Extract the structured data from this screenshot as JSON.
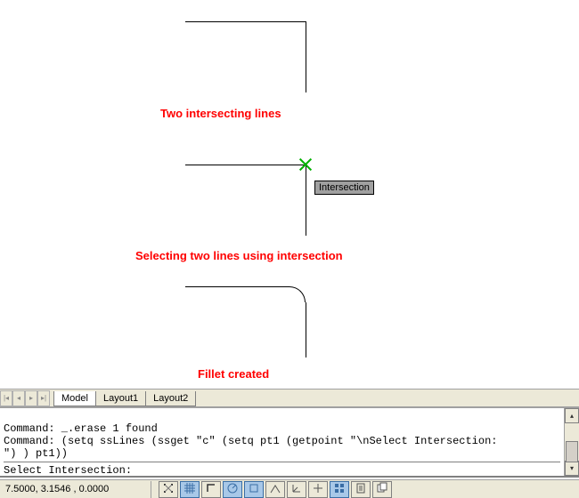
{
  "canvas": {
    "label_two_lines": "Two intersecting lines",
    "label_select_intersection": "Selecting two lines using intersection",
    "label_fillet": "Fillet created",
    "tooltip_intersection": "Intersection",
    "snap_color": "#00b000"
  },
  "tabs": {
    "items": [
      "Model",
      "Layout1",
      "Layout2"
    ],
    "active_index": 0
  },
  "command": {
    "history": [
      "Command: _.erase 1 found",
      "Command: (setq ssLines (ssget \"c\" (setq pt1 (getpoint \"\\nSelect Intersection:",
      "\") ) pt1))"
    ],
    "prompt": "Select Intersection:"
  },
  "status": {
    "coords": "7.5000, 3.1546 , 0.0000",
    "buttons": [
      {
        "name": "snap-icon",
        "active": false
      },
      {
        "name": "grid-icon",
        "active": true
      },
      {
        "name": "ortho-icon",
        "active": false
      },
      {
        "name": "polar-icon",
        "active": true
      },
      {
        "name": "osnap-icon",
        "active": true
      },
      {
        "name": "otrack-icon",
        "active": false
      },
      {
        "name": "ducs-icon",
        "active": false
      },
      {
        "name": "dyn-icon",
        "active": false
      },
      {
        "name": "lwt-icon",
        "active": true
      },
      {
        "name": "qp-icon",
        "active": false
      },
      {
        "name": "model-icon",
        "active": false
      }
    ]
  }
}
